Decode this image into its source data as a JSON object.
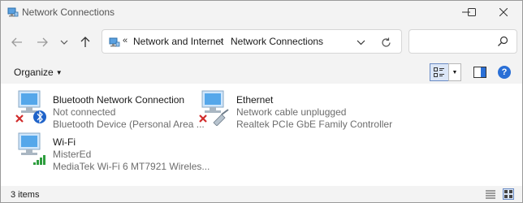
{
  "window": {
    "title": "Network Connections",
    "controls": {
      "minimize": "minimize-icon",
      "maximize": "maximize-icon",
      "close": "close-icon"
    }
  },
  "nav": {
    "back": "arrow-left-icon",
    "forward": "arrow-right-icon",
    "recent": "chevron-down-icon",
    "up": "arrow-up-icon"
  },
  "address": {
    "overflow": "«",
    "crumbs": [
      "Network and Internet",
      "Network Connections"
    ],
    "separator": "›"
  },
  "search": {
    "placeholder": ""
  },
  "toolbar": {
    "organize_label": "Organize"
  },
  "items": [
    {
      "name": "Bluetooth Network Connection",
      "status": "Not connected",
      "device": "Bluetooth Device (Personal Area ...",
      "badge": "bluetooth-icon",
      "error": true
    },
    {
      "name": "Ethernet",
      "status": "Network cable unplugged",
      "device": "Realtek PCIe GbE Family Controller",
      "badge": "ethernet-cable-icon",
      "error": true
    },
    {
      "name": "Wi-Fi",
      "status": "MisterEd",
      "device": "MediaTek Wi-Fi 6 MT7921 Wireles...",
      "badge": "wifi-signal-icon",
      "error": false
    }
  ],
  "status_bar": {
    "count": "3 items"
  },
  "colors": {
    "accent": "#2a6fd6",
    "error": "#d12b2b",
    "chrome": "#f3f3f3",
    "wifi": "#2e9e3e"
  }
}
